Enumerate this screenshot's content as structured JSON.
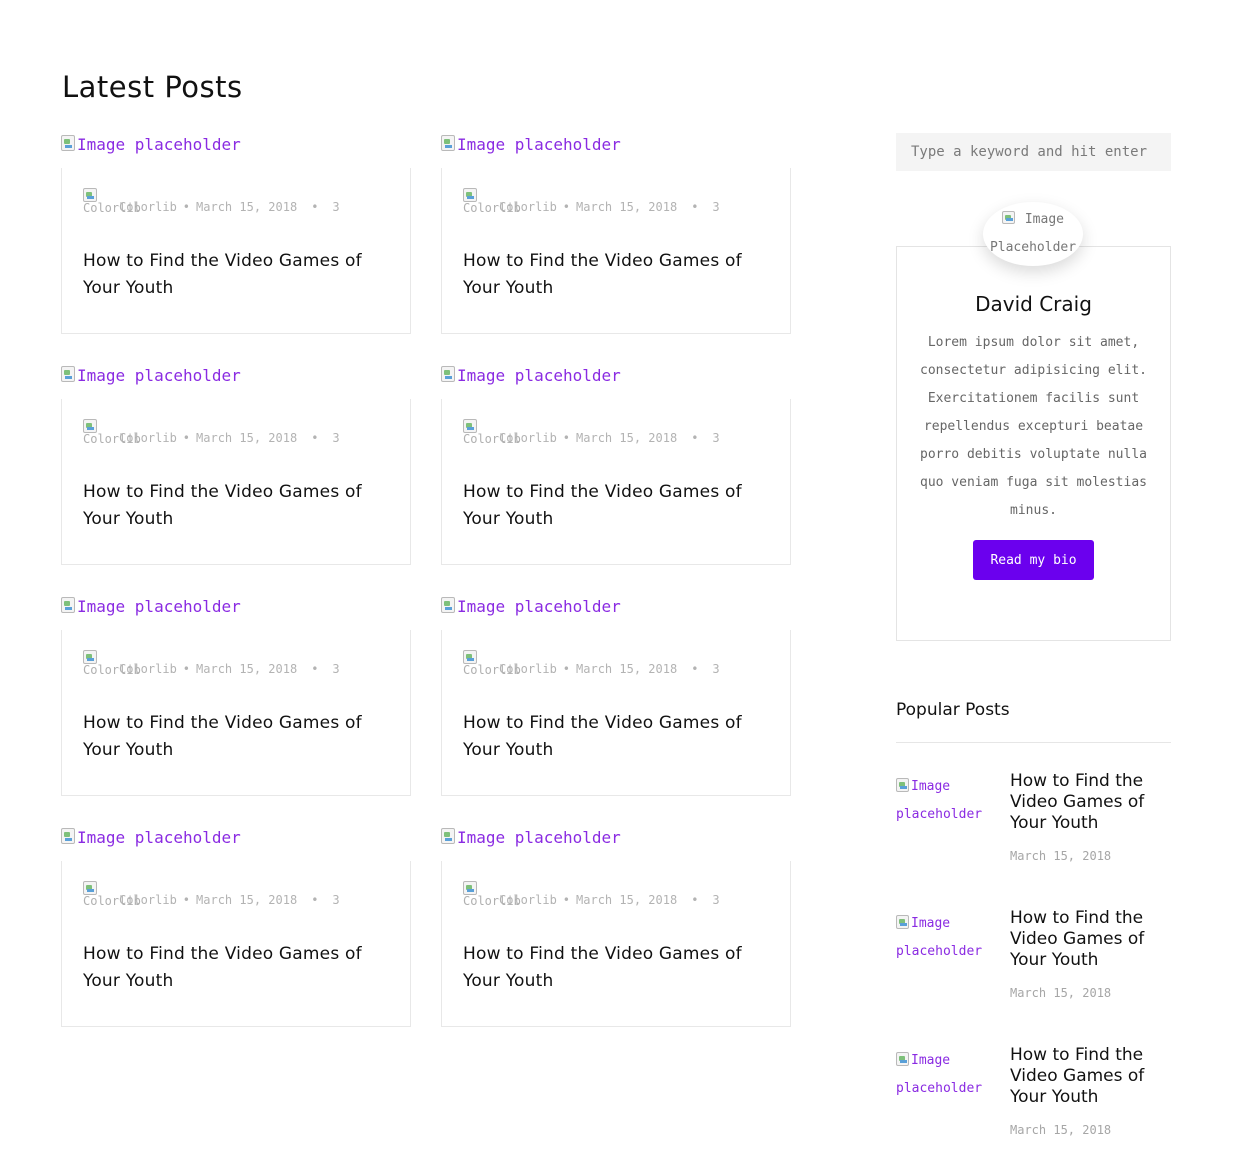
{
  "page": {
    "title": "Latest Posts"
  },
  "posts": [
    {
      "image_alt": "Image placeholder",
      "author": "Colorlib",
      "date": "March 15, 2018",
      "comments": "3",
      "title": "How to Find the Video Games of Your Youth"
    },
    {
      "image_alt": "Image placeholder",
      "author": "Colorlib",
      "date": "March 15, 2018",
      "comments": "3",
      "title": "How to Find the Video Games of Your Youth"
    },
    {
      "image_alt": "Image placeholder",
      "author": "Colorlib",
      "date": "March 15, 2018",
      "comments": "3",
      "title": "How to Find the Video Games of Your Youth"
    },
    {
      "image_alt": "Image placeholder",
      "author": "Colorlib",
      "date": "March 15, 2018",
      "comments": "3",
      "title": "How to Find the Video Games of Your Youth"
    },
    {
      "image_alt": "Image placeholder",
      "author": "Colorlib",
      "date": "March 15, 2018",
      "comments": "3",
      "title": "How to Find the Video Games of Your Youth"
    },
    {
      "image_alt": "Image placeholder",
      "author": "Colorlib",
      "date": "March 15, 2018",
      "comments": "3",
      "title": "How to Find the Video Games of Your Youth"
    },
    {
      "image_alt": "Image placeholder",
      "author": "Colorlib",
      "date": "March 15, 2018",
      "comments": "3",
      "title": "How to Find the Video Games of Your Youth"
    },
    {
      "image_alt": "Image placeholder",
      "author": "Colorlib",
      "date": "March 15, 2018",
      "comments": "3",
      "title": "How to Find the Video Games of Your Youth"
    }
  ],
  "meta_separator": "•",
  "sidebar": {
    "search": {
      "placeholder": "Type a keyword and hit enter"
    },
    "bio": {
      "image_alt": "Image Placeholder",
      "name": "David Craig",
      "text": "Lorem ipsum dolor sit amet, consectetur adipisicing elit. Exercitationem facilis sunt repellendus excepturi beatae porro debitis voluptate nulla quo veniam fuga sit molestias minus.",
      "button_label": "Read my bio"
    },
    "popular": {
      "heading": "Popular Posts",
      "items": [
        {
          "image_alt": "Image placeholder",
          "title": "How to Find the Video Games of Your Youth",
          "date": "March 15, 2018"
        },
        {
          "image_alt": "Image placeholder",
          "title": "How to Find the Video Games of Your Youth",
          "date": "March 15, 2018"
        },
        {
          "image_alt": "Image placeholder",
          "title": "How to Find the Video Games of Your Youth",
          "date": "March 15, 2018"
        }
      ]
    }
  },
  "colors": {
    "accent": "#6b00ee",
    "link": "#8a2be2",
    "muted": "#b3b3b3"
  }
}
